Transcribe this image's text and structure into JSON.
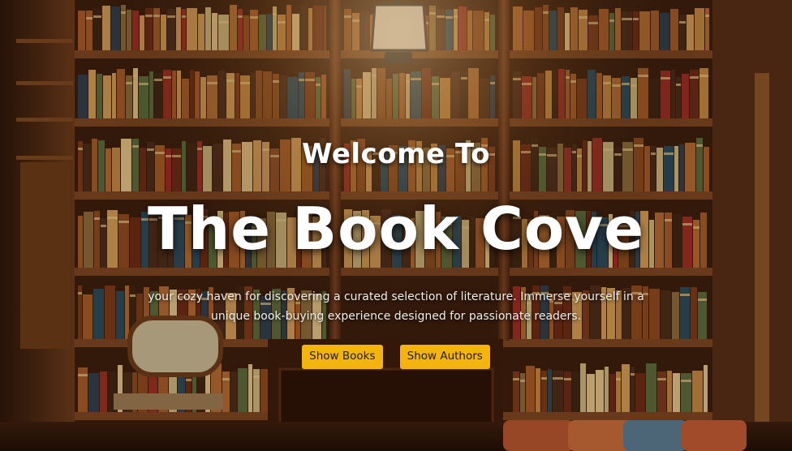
{
  "hero": {
    "welcome": "Welcome To",
    "title": "The Book Cove",
    "tagline": "your cozy haven for discovering a curated selection of literature. Immerse yourself in a unique book-buying experience designed for passionate readers."
  },
  "buttons": {
    "show_books": "Show Books",
    "show_authors": "Show Authors"
  },
  "colors": {
    "button_bg": "#f5b40a",
    "button_text": "#1e1e1e",
    "wood": "#6b3a1c",
    "text": "#ffffff"
  }
}
